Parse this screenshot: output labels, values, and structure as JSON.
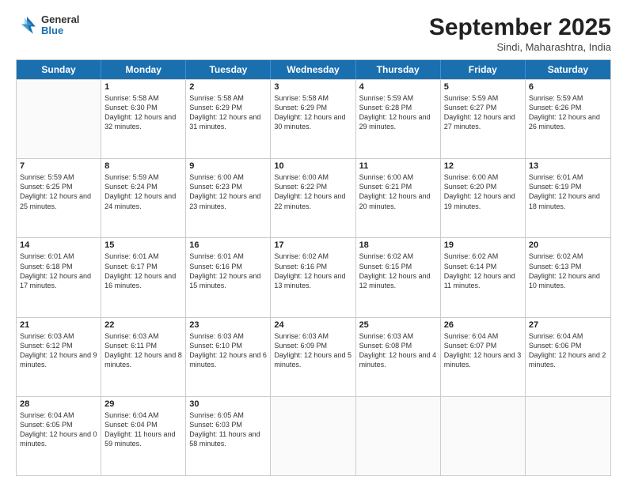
{
  "header": {
    "logo": {
      "general": "General",
      "blue": "Blue"
    },
    "title": "September 2025",
    "location": "Sindi, Maharashtra, India"
  },
  "weekdays": [
    "Sunday",
    "Monday",
    "Tuesday",
    "Wednesday",
    "Thursday",
    "Friday",
    "Saturday"
  ],
  "rows": [
    [
      {
        "day": "",
        "empty": true
      },
      {
        "day": "1",
        "sunrise": "5:58 AM",
        "sunset": "6:30 PM",
        "daylight": "12 hours and 32 minutes."
      },
      {
        "day": "2",
        "sunrise": "5:58 AM",
        "sunset": "6:29 PM",
        "daylight": "12 hours and 31 minutes."
      },
      {
        "day": "3",
        "sunrise": "5:58 AM",
        "sunset": "6:29 PM",
        "daylight": "12 hours and 30 minutes."
      },
      {
        "day": "4",
        "sunrise": "5:59 AM",
        "sunset": "6:28 PM",
        "daylight": "12 hours and 29 minutes."
      },
      {
        "day": "5",
        "sunrise": "5:59 AM",
        "sunset": "6:27 PM",
        "daylight": "12 hours and 27 minutes."
      },
      {
        "day": "6",
        "sunrise": "5:59 AM",
        "sunset": "6:26 PM",
        "daylight": "12 hours and 26 minutes."
      }
    ],
    [
      {
        "day": "7",
        "sunrise": "5:59 AM",
        "sunset": "6:25 PM",
        "daylight": "12 hours and 25 minutes."
      },
      {
        "day": "8",
        "sunrise": "5:59 AM",
        "sunset": "6:24 PM",
        "daylight": "12 hours and 24 minutes."
      },
      {
        "day": "9",
        "sunrise": "6:00 AM",
        "sunset": "6:23 PM",
        "daylight": "12 hours and 23 minutes."
      },
      {
        "day": "10",
        "sunrise": "6:00 AM",
        "sunset": "6:22 PM",
        "daylight": "12 hours and 22 minutes."
      },
      {
        "day": "11",
        "sunrise": "6:00 AM",
        "sunset": "6:21 PM",
        "daylight": "12 hours and 20 minutes."
      },
      {
        "day": "12",
        "sunrise": "6:00 AM",
        "sunset": "6:20 PM",
        "daylight": "12 hours and 19 minutes."
      },
      {
        "day": "13",
        "sunrise": "6:01 AM",
        "sunset": "6:19 PM",
        "daylight": "12 hours and 18 minutes."
      }
    ],
    [
      {
        "day": "14",
        "sunrise": "6:01 AM",
        "sunset": "6:18 PM",
        "daylight": "12 hours and 17 minutes."
      },
      {
        "day": "15",
        "sunrise": "6:01 AM",
        "sunset": "6:17 PM",
        "daylight": "12 hours and 16 minutes."
      },
      {
        "day": "16",
        "sunrise": "6:01 AM",
        "sunset": "6:16 PM",
        "daylight": "12 hours and 15 minutes."
      },
      {
        "day": "17",
        "sunrise": "6:02 AM",
        "sunset": "6:16 PM",
        "daylight": "12 hours and 13 minutes."
      },
      {
        "day": "18",
        "sunrise": "6:02 AM",
        "sunset": "6:15 PM",
        "daylight": "12 hours and 12 minutes."
      },
      {
        "day": "19",
        "sunrise": "6:02 AM",
        "sunset": "6:14 PM",
        "daylight": "12 hours and 11 minutes."
      },
      {
        "day": "20",
        "sunrise": "6:02 AM",
        "sunset": "6:13 PM",
        "daylight": "12 hours and 10 minutes."
      }
    ],
    [
      {
        "day": "21",
        "sunrise": "6:03 AM",
        "sunset": "6:12 PM",
        "daylight": "12 hours and 9 minutes."
      },
      {
        "day": "22",
        "sunrise": "6:03 AM",
        "sunset": "6:11 PM",
        "daylight": "12 hours and 8 minutes."
      },
      {
        "day": "23",
        "sunrise": "6:03 AM",
        "sunset": "6:10 PM",
        "daylight": "12 hours and 6 minutes."
      },
      {
        "day": "24",
        "sunrise": "6:03 AM",
        "sunset": "6:09 PM",
        "daylight": "12 hours and 5 minutes."
      },
      {
        "day": "25",
        "sunrise": "6:03 AM",
        "sunset": "6:08 PM",
        "daylight": "12 hours and 4 minutes."
      },
      {
        "day": "26",
        "sunrise": "6:04 AM",
        "sunset": "6:07 PM",
        "daylight": "12 hours and 3 minutes."
      },
      {
        "day": "27",
        "sunrise": "6:04 AM",
        "sunset": "6:06 PM",
        "daylight": "12 hours and 2 minutes."
      }
    ],
    [
      {
        "day": "28",
        "sunrise": "6:04 AM",
        "sunset": "6:05 PM",
        "daylight": "12 hours and 0 minutes."
      },
      {
        "day": "29",
        "sunrise": "6:04 AM",
        "sunset": "6:04 PM",
        "daylight": "11 hours and 59 minutes."
      },
      {
        "day": "30",
        "sunrise": "6:05 AM",
        "sunset": "6:03 PM",
        "daylight": "11 hours and 58 minutes."
      },
      {
        "day": "",
        "empty": true
      },
      {
        "day": "",
        "empty": true
      },
      {
        "day": "",
        "empty": true
      },
      {
        "day": "",
        "empty": true
      }
    ]
  ]
}
